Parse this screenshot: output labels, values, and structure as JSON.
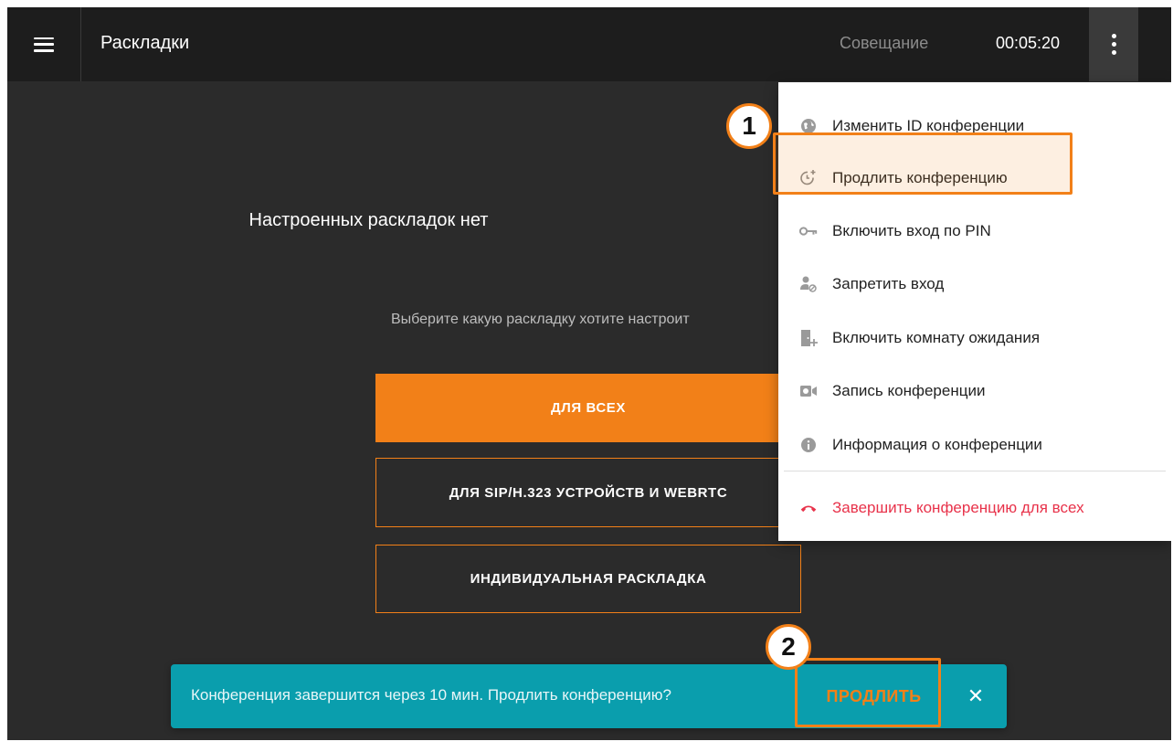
{
  "header": {
    "title": "Раскладки",
    "meeting_label": "Совещание",
    "timer": "00:05:20"
  },
  "main": {
    "empty_title": "Настроенных раскладок нет",
    "empty_subtitle": "Выберите какую раскладку хотите настроит",
    "buttons": [
      {
        "label": "ДЛЯ ВСЕХ"
      },
      {
        "label": "ДЛЯ SIP/H.323 УСТРОЙСТВ И WEBRTC"
      },
      {
        "label": "ИНДИВИДУАЛЬНАЯ РАСКЛАДКА"
      }
    ]
  },
  "menu": {
    "items": [
      {
        "label": "Изменить ID конференции",
        "icon": "globe-icon"
      },
      {
        "label": "Продлить конференцию",
        "icon": "clock-plus-icon"
      },
      {
        "label": "Включить вход по PIN",
        "icon": "key-icon"
      },
      {
        "label": "Запретить вход",
        "icon": "user-block-icon"
      },
      {
        "label": "Включить комнату ожидания",
        "icon": "door-icon"
      },
      {
        "label": "Запись конференции",
        "icon": "record-icon"
      },
      {
        "label": "Информация о конференции",
        "icon": "info-icon"
      },
      {
        "label": "Завершить конференцию для всех",
        "icon": "hangup-icon"
      }
    ]
  },
  "annotations": {
    "step1": "1",
    "step2": "2"
  },
  "snackbar": {
    "message": "Конференция завершится через 10 мин. Продлить конференцию?",
    "action_label": "ПРОДЛИТЬ",
    "close_glyph": "✕"
  },
  "colors": {
    "accent": "#f28018",
    "snackbar": "#0a9ead",
    "danger": "#e8324a"
  }
}
